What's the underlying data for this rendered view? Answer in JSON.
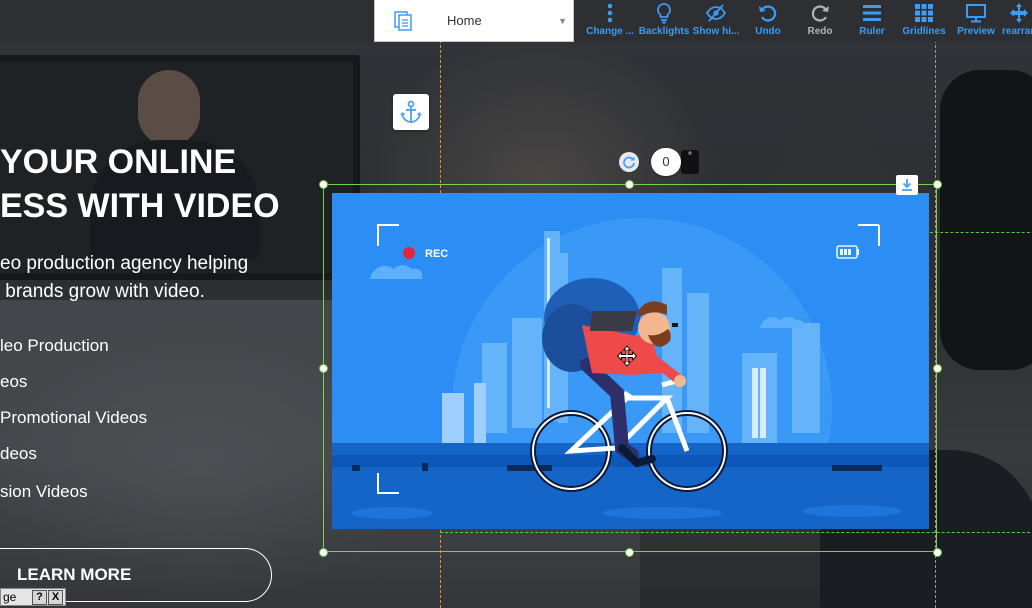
{
  "toolbar": {
    "page_select": {
      "value": "Home"
    },
    "tools": [
      {
        "label": "Change ...",
        "icon": "more-vertical-icon"
      },
      {
        "label": "Backlights",
        "icon": "lightbulb-icon"
      },
      {
        "label": "Show hi...",
        "icon": "eye-slash-icon"
      },
      {
        "label": "Undo",
        "icon": "undo-icon"
      },
      {
        "label": "Redo",
        "icon": "redo-icon"
      },
      {
        "label": "Ruler",
        "icon": "ruler-icon"
      },
      {
        "label": "Gridlines",
        "icon": "grid-icon"
      },
      {
        "label": "Preview",
        "icon": "monitor-icon"
      },
      {
        "label": "rearrar",
        "icon": "move-arrows-icon"
      }
    ],
    "accent_color": "#3b9bf5"
  },
  "hero": {
    "title": "YOUR ONLINE\nESS WITH VIDEO",
    "subtitle": "eo production agency helping\n brands grow with video.",
    "services": [
      "leo Production",
      "eos",
      "Promotional Videos",
      "deos",
      "sion Videos"
    ],
    "cta_label": "LEARN MORE"
  },
  "editor": {
    "rotation_value": "0",
    "degree_symbol": "°",
    "mini_bar": {
      "label": "ge",
      "help": "?",
      "close": "X"
    },
    "selection_color": "#6cc23d"
  },
  "illustration": {
    "rec_label": "REC",
    "bg_color": "#2c8df5"
  }
}
